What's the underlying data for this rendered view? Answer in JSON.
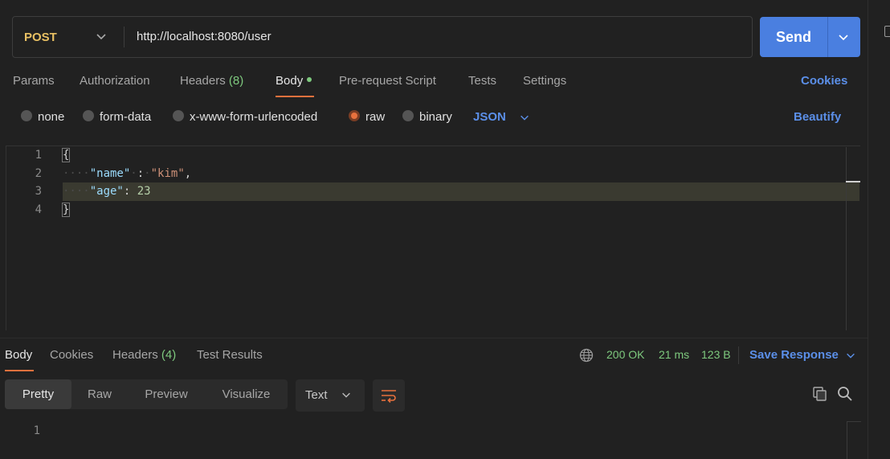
{
  "request": {
    "method": "POST",
    "url": "http://localhost:8080/user",
    "send_label": "Send"
  },
  "request_tabs": [
    {
      "label": "Params"
    },
    {
      "label": "Authorization"
    },
    {
      "label": "Headers",
      "count": "(8)"
    },
    {
      "label": "Body"
    },
    {
      "label": "Pre-request Script"
    },
    {
      "label": "Tests"
    },
    {
      "label": "Settings"
    }
  ],
  "cookies_label": "Cookies",
  "body_types": [
    {
      "label": "none",
      "selected": false
    },
    {
      "label": "form-data",
      "selected": false
    },
    {
      "label": "x-www-form-urlencoded",
      "selected": false
    },
    {
      "label": "raw",
      "selected": true
    },
    {
      "label": "binary",
      "selected": false
    }
  ],
  "raw_format": "JSON",
  "beautify_label": "Beautify",
  "editor": {
    "line_numbers": [
      "1",
      "2",
      "3",
      "4"
    ],
    "open_brace": "{",
    "close_brace": "}",
    "name_key": "\"name\"",
    "name_value": "\"kim\"",
    "age_key": "\"age\"",
    "age_value": "23"
  },
  "response_tabs": [
    {
      "label": "Body"
    },
    {
      "label": "Cookies"
    },
    {
      "label": "Headers",
      "count": "(4)"
    },
    {
      "label": "Test Results"
    }
  ],
  "response_meta": {
    "status": "200 OK",
    "time": "21 ms",
    "size": "123 B",
    "save_label": "Save Response"
  },
  "view_modes": [
    "Pretty",
    "Raw",
    "Preview",
    "Visualize"
  ],
  "response_format": "Text",
  "response_line_numbers": [
    "1"
  ],
  "colors": {
    "accent": "#e8713d",
    "link": "#5b8fe8",
    "send": "#4a7fe0",
    "success": "#7ec97e",
    "method": "#e8c063"
  }
}
